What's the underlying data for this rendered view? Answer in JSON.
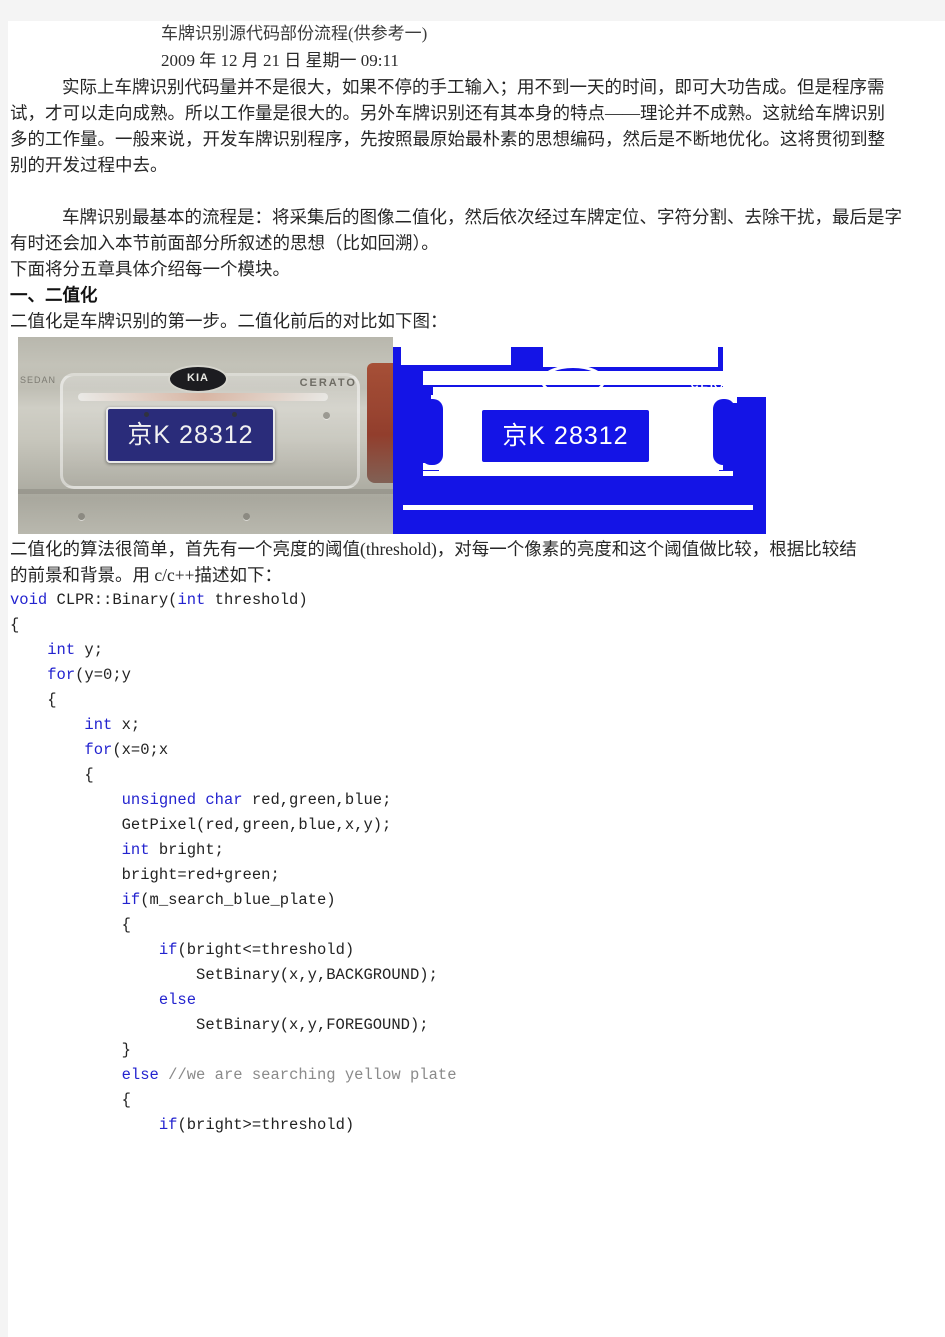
{
  "document": {
    "title": "车牌识别源代码部份流程(供参考一)",
    "date": "2009 年 12 月 21 日  星期一  09:11",
    "paragraphs": [
      "实际上车牌识别代码量并不是很大，如果不停的手工输入；用不到一天的时间，即可大功告成。但是程序需",
      "试，才可以走向成熟。所以工作量是很大的。另外车牌识别还有其本身的特点——理论并不成熟。这就给车牌识别",
      "多的工作量。一般来说，开发车牌识别程序，先按照最原始最朴素的思想编码，然后是不断地优化。这将贯彻到整",
      "别的开发过程中去。",
      "车牌识别最基本的流程是：将采集后的图像二值化，然后依次经过车牌定位、字符分割、去除干扰，最后是字",
      "有时还会加入本节前面部分所叙述的思想（比如回溯）。",
      "下面将分五章具体介绍每一个模块。"
    ],
    "section_heading": "一、二值化",
    "section_intro": "二值化是车牌识别的第一步。二值化前后的对比如下图：",
    "after_figure": [
      "二值化的算法很简单，首先有一个亮度的阈值(threshold)，对每一个像素的亮度和这个阈值做比较，根据比较结",
      "的前景和背景。用 c/c++描述如下："
    ]
  },
  "figure": {
    "original": {
      "caption_alt": "车辆尾部彩色照片",
      "brand_badge": "KIA",
      "model_text": "CERATO",
      "trim_text": "SEDAN",
      "plate_number": "京K 28312",
      "plate_color": "#2a2c7a",
      "body_color": "#c3c2b8"
    },
    "binarized": {
      "caption_alt": "二值化后的图像",
      "brand_badge": "KIA",
      "model_text": "CERATO",
      "plate_number": "京K 28312",
      "foreground_color": "#1414e6",
      "background_color": "#ffffff"
    }
  },
  "code": {
    "language": "c/c++",
    "keyword_color": "#2323cf",
    "comment_color": "#8a8a8a",
    "lines": [
      [
        {
          "t": "void ",
          "c": "kw"
        },
        {
          "t": "CLPR::Binary(",
          "c": ""
        },
        {
          "t": "int",
          "c": "kw"
        },
        {
          "t": " threshold)",
          "c": ""
        }
      ],
      [
        {
          "t": "{",
          "c": ""
        }
      ],
      [
        {
          "t": "    ",
          "c": ""
        },
        {
          "t": "int",
          "c": "kw"
        },
        {
          "t": " y;",
          "c": ""
        }
      ],
      [
        {
          "t": "    ",
          "c": ""
        },
        {
          "t": "for",
          "c": "kw"
        },
        {
          "t": "(y=0;y",
          "c": ""
        }
      ],
      [
        {
          "t": "    {",
          "c": ""
        }
      ],
      [
        {
          "t": "        ",
          "c": ""
        },
        {
          "t": "int",
          "c": "kw"
        },
        {
          "t": " x;",
          "c": ""
        }
      ],
      [
        {
          "t": "        ",
          "c": ""
        },
        {
          "t": "for",
          "c": "kw"
        },
        {
          "t": "(x=0;x",
          "c": ""
        }
      ],
      [
        {
          "t": "        {",
          "c": ""
        }
      ],
      [
        {
          "t": "            ",
          "c": ""
        },
        {
          "t": "unsigned char",
          "c": "kw"
        },
        {
          "t": " red,green,blue;",
          "c": ""
        }
      ],
      [
        {
          "t": "            GetPixel(red,green,blue,x,y);",
          "c": ""
        }
      ],
      [
        {
          "t": "            ",
          "c": ""
        },
        {
          "t": "int",
          "c": "kw"
        },
        {
          "t": " bright;",
          "c": ""
        }
      ],
      [
        {
          "t": "            bright=red+green;",
          "c": ""
        }
      ],
      [
        {
          "t": "            ",
          "c": ""
        },
        {
          "t": "if",
          "c": "kw"
        },
        {
          "t": "(m_search_blue_plate)",
          "c": ""
        }
      ],
      [
        {
          "t": "            {",
          "c": ""
        }
      ],
      [
        {
          "t": "                ",
          "c": ""
        },
        {
          "t": "if",
          "c": "kw"
        },
        {
          "t": "(bright<=threshold)",
          "c": ""
        }
      ],
      [
        {
          "t": "                    SetBinary(x,y,BACKGROUND);",
          "c": ""
        }
      ],
      [
        {
          "t": "                ",
          "c": ""
        },
        {
          "t": "else",
          "c": "kw"
        }
      ],
      [
        {
          "t": "                    SetBinary(x,y,FOREGOUND);",
          "c": ""
        }
      ],
      [
        {
          "t": "            }",
          "c": ""
        }
      ],
      [
        {
          "t": "            ",
          "c": ""
        },
        {
          "t": "else",
          "c": "kw"
        },
        {
          "t": " ",
          "c": ""
        },
        {
          "t": "//we are searching yellow plate",
          "c": "cmt"
        }
      ],
      [
        {
          "t": "            {",
          "c": ""
        }
      ],
      [
        {
          "t": "                ",
          "c": ""
        },
        {
          "t": "if",
          "c": "kw"
        },
        {
          "t": "(bright>=threshold)",
          "c": ""
        }
      ]
    ]
  }
}
